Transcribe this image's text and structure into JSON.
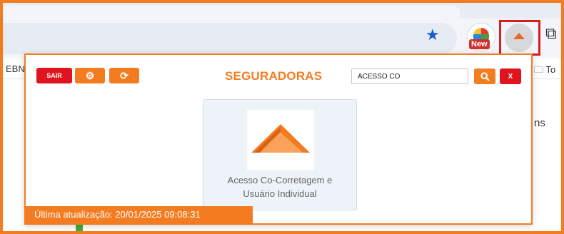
{
  "browser": {
    "new_badge": "New",
    "bookmark_left_partial": "EBN",
    "bookmark_right_partial": "To",
    "background_text_partial": "ns"
  },
  "popup": {
    "buttons": {
      "sair_label": "SAIR",
      "settings_icon": "gear-icon",
      "refresh_icon": "refresh-icon",
      "search_icon": "magnifier-icon",
      "clear_label": "X"
    },
    "title": "SEGURADORAS",
    "search": {
      "value": "ACESSO CO",
      "placeholder": ""
    },
    "results": [
      {
        "name_line1": "Acesso Co-Corretagem e",
        "name_line2": "Usuário Individual",
        "logo_icon": "orange-roof-logo"
      }
    ],
    "status": "Última atualização: 20/01/2025 09:08:31"
  },
  "colors": {
    "accent": "#f47c20",
    "danger": "#e0141f",
    "card_bg": "#eef3fa",
    "title": "#f47c20",
    "highlight_box": "#d81d1d"
  }
}
